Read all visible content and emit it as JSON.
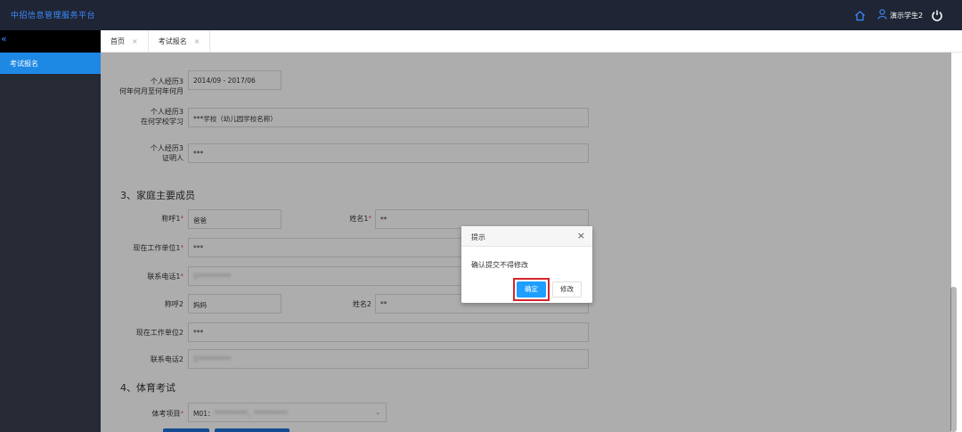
{
  "header": {
    "app_title": "中招信息管理服务平台",
    "user_name": "演示学生2"
  },
  "sidebar": {
    "collapse_label": "«",
    "items": [
      {
        "label": "考试报名",
        "active": true
      }
    ]
  },
  "tabs": [
    {
      "label": "首页",
      "close": "×"
    },
    {
      "label": "考试报名",
      "close": "×"
    }
  ],
  "form": {
    "resume3_period_label_1": "个人经历3",
    "resume3_period_label_2": "何年何月至何年何月",
    "resume3_period_value": "2014/09 - 2017/06",
    "resume3_school_label_1": "个人经历3",
    "resume3_school_label_2": "在何学校学习",
    "resume3_school_value": "***学校（幼儿园学校名称）",
    "resume3_witness_label_1": "个人经历3",
    "resume3_witness_label_2": "证明人",
    "resume3_witness_value": "***",
    "section_family": "3、家庭主要成员",
    "relation1_label": "称呼1",
    "relation1_value": "爸爸",
    "name1_label": "姓名1",
    "name1_value": "**",
    "work1_label": "现在工作单位1",
    "work1_value": "***",
    "phone1_label": "联系电话1",
    "phone1_value": "1**********",
    "relation2_label": "称呼2",
    "relation2_value": "妈妈",
    "name2_label": "姓名2",
    "name2_value": "**",
    "work2_label": "现在工作单位2",
    "work2_value": "***",
    "phone2_label": "联系电话2",
    "phone2_value": "1**********",
    "section_pe": "4、体育考试",
    "pe_label": "体考项目",
    "pe_value": "M01：",
    "pe_value_blur": "**********、**********",
    "required_mark": "*"
  },
  "dialog": {
    "title": "提示",
    "close": "×",
    "message": "确认提交不得修改",
    "confirm_label": "确定",
    "modify_label": "修改"
  },
  "colors": {
    "topbar": "#1f2534",
    "accent": "#1e88e5",
    "confirm": "#1e9fff",
    "highlight": "#d6262b"
  },
  "icons": [
    "home-icon",
    "user-icon",
    "power-icon",
    "close-icon",
    "chevron-down-icon"
  ]
}
